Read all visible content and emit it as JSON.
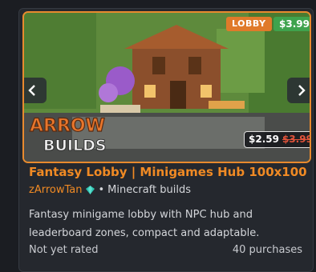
{
  "listing": {
    "badges": {
      "lobby": "LOBBY",
      "price": "$3.99"
    },
    "logo_text_top": "ARROW",
    "logo_text_bottom": "BUILDS",
    "sale_price": "$2.59",
    "original_price": "$3.99",
    "title": "Fantasy Lobby | Minigames Hub 100x100",
    "author": "zArrowTan",
    "category_separator": "•",
    "category": "Minecraft builds",
    "description": "Fantasy minigame lobby with NPC hub and leaderboard zones, compact and adaptable.",
    "rating": "Not yet rated",
    "purchases": "40 purchases"
  },
  "colors": {
    "accent": "#f08a24",
    "lobby_badge": "#e07a2a",
    "price_badge": "#3fa34d",
    "strike_price": "#e0533a"
  },
  "icons": {
    "prev": "chevron-left-icon",
    "next": "chevron-right-icon",
    "verified": "verified-gem-icon"
  }
}
